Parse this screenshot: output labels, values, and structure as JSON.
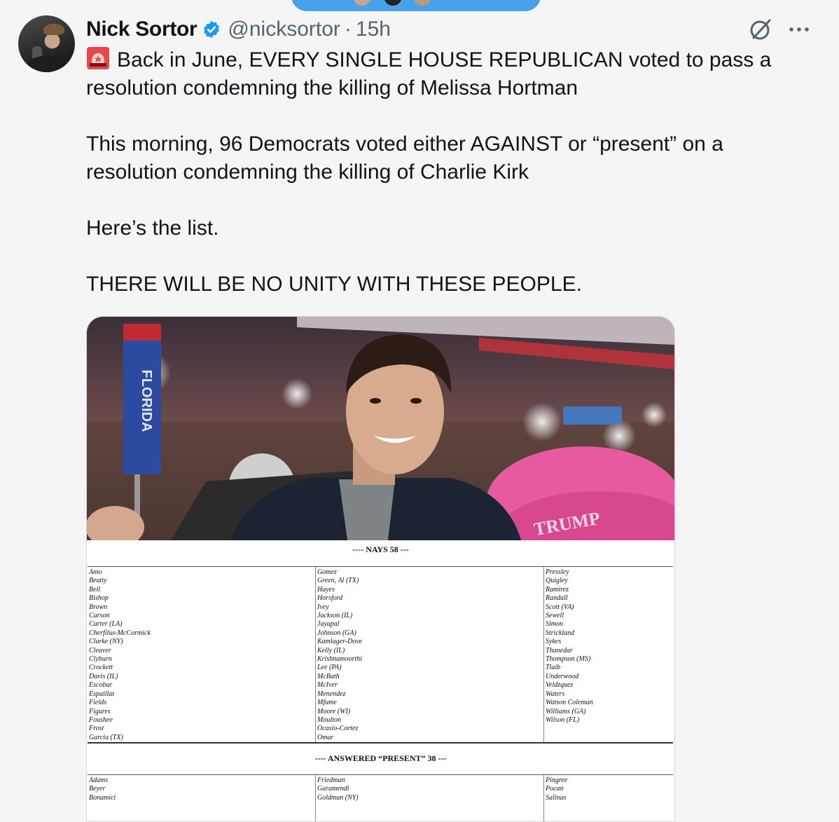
{
  "author": {
    "name": "Nick Sortor",
    "handle": "@nicksortor",
    "separator": "·",
    "time": "15h",
    "avatar_icon": "profile-photo",
    "verified_icon": "verified-badge-icon"
  },
  "actions": {
    "grok_icon": "grok-icon",
    "more_icon": "more-options-icon"
  },
  "tweet": {
    "siren_icon": "rotating-light-emoji",
    "line1": "Back in June, EVERY SINGLE HOUSE REPUBLICAN voted to pass a resolution condemning the killing of Melissa Hortman",
    "line2": "This morning, 96 Democrats voted either AGAINST or “present” on a resolution condemning the killing of Charlie Kirk",
    "line3": "Here’s the list.",
    "line4": "THERE WILL BE NO UNITY WITH THESE PEOPLE."
  },
  "media": {
    "photo_sign": "FLORIDA",
    "photo_hat": "TRUMP",
    "nays_header": "---- NAYS    58 ---",
    "nays_col1": [
      "Amo",
      "Beatty",
      "Bell",
      "Bishop",
      "Brown",
      "Carson",
      "Carter (LA)",
      "Cherfilus-McCormick",
      "Clarke (NY)",
      "Cleaver",
      "Clyburn",
      "Crockett",
      "Davis (IL)",
      "Escobar",
      "Espaillat",
      "Fields",
      "Figures",
      "Foushee",
      "Frost",
      "Garcia (TX)"
    ],
    "nays_col2": [
      "Gomez",
      "Green, Al (TX)",
      "Hayes",
      "Horsford",
      "Ivey",
      "Jackson (IL)",
      "Jayapal",
      "Johnson (GA)",
      "Kamlager-Dove",
      "Kelly (IL)",
      "Krishnamoorthi",
      "Lee (PA)",
      "McBath",
      "McIver",
      "Menendez",
      "Mfume",
      "Moore (WI)",
      "Moulton",
      "Ocasio-Cortez",
      "Omar"
    ],
    "nays_col3": [
      "Pressley",
      "Quigley",
      "Ramirez",
      "Randall",
      "Scott (VA)",
      "Sewell",
      "Simon",
      "Strickland",
      "Sykes",
      "Thanedar",
      "Thompson (MS)",
      "Tlaib",
      "Underwood",
      "Veldzquez",
      "Waters",
      "Watson Coleman",
      "Williams (GA)",
      "Wilson (FL)"
    ],
    "present_header": "---- ANSWERED “PRESENT”    38 ---",
    "present_col1": [
      "Adams",
      "Beyer",
      "Bonamici"
    ],
    "present_col2": [
      "Friedman",
      "Garamendi",
      "Goldman (NY)"
    ],
    "present_col3": [
      "Pingree",
      "Pocan",
      "Salinas"
    ]
  }
}
